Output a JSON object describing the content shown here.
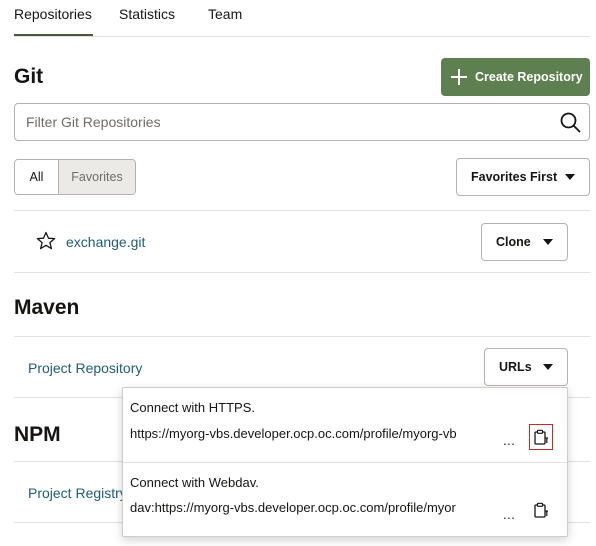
{
  "tabs": [
    {
      "label": "Repositories",
      "active": true
    },
    {
      "label": "Statistics",
      "active": false
    },
    {
      "label": "Team",
      "active": false
    }
  ],
  "git": {
    "title": "Git",
    "create_button": "Create Repository",
    "search_placeholder": "Filter Git Repositories",
    "filter": {
      "all": "All",
      "favorites": "Favorites"
    },
    "sort_select": "Favorites First",
    "repos": [
      {
        "name": "exchange.git",
        "favorite": false,
        "action": "Clone"
      }
    ]
  },
  "maven": {
    "title": "Maven",
    "item": "Project Repository",
    "action": "URLs"
  },
  "npm": {
    "title": "NPM",
    "item": "Project Registry"
  },
  "urls_popup": {
    "https": {
      "label": "Connect with HTTPS.",
      "url": "https://myorg-vbs.developer.ocp.oc.com/profile/myorg-vb"
    },
    "webdav": {
      "label": "Connect with Webdav.",
      "url": "dav:https://myorg-vbs.developer.ocp.oc.com/profile/myor"
    },
    "ellipsis": "..."
  },
  "colors": {
    "primary": "#5e7f4f",
    "link": "#1f5c7a",
    "focus": "#c72828"
  }
}
